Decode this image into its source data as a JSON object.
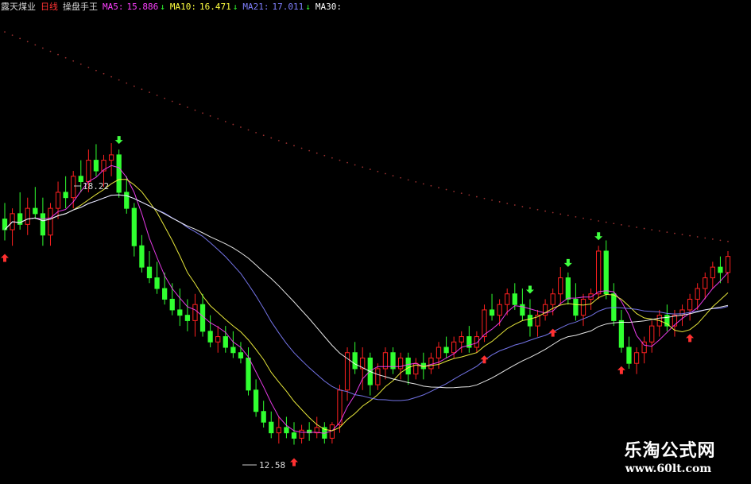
{
  "header": {
    "stock_name": "露天煤业",
    "period": "日线",
    "tool": "操盘手王",
    "ma_items": [
      {
        "label": "MA5:",
        "value": "15.886",
        "arrow": "↓",
        "color": "#ff40ff"
      },
      {
        "label": "MA10:",
        "value": "16.471",
        "arrow": "↓",
        "color": "#ffff40"
      },
      {
        "label": "MA21:",
        "value": "17.011",
        "arrow": "↓",
        "color": "#8080ff"
      },
      {
        "label": "MA30:",
        "value": "",
        "arrow": "",
        "color": "#ffffff"
      }
    ]
  },
  "annotations": {
    "high_label": "18.22",
    "low_label": "12.58"
  },
  "watermark": {
    "cn": "乐淘公式网",
    "url": "www.60lt.com"
  },
  "colors": {
    "background": "#000000",
    "up_candle": "#ff2020",
    "down_candle": "#30ff30",
    "ma5": "#ff40ff",
    "ma10": "#ffff40",
    "ma21": "#8080ff",
    "ma30": "#ffffff",
    "long_ma": "#9a3030",
    "buy_arrow": "#ff3030",
    "sell_arrow": "#40ff40"
  },
  "chart_data": {
    "type": "candlestick",
    "title": "",
    "ylim": [
      12.2,
      20.6
    ],
    "candles": [
      {
        "o": 16.8,
        "h": 17.1,
        "l": 16.4,
        "c": 16.6
      },
      {
        "o": 16.6,
        "h": 17.0,
        "l": 16.3,
        "c": 16.9
      },
      {
        "o": 16.9,
        "h": 17.3,
        "l": 16.6,
        "c": 16.7
      },
      {
        "o": 16.7,
        "h": 17.2,
        "l": 16.5,
        "c": 17.0
      },
      {
        "o": 17.0,
        "h": 17.4,
        "l": 16.8,
        "c": 16.9
      },
      {
        "o": 16.9,
        "h": 17.2,
        "l": 16.3,
        "c": 16.5
      },
      {
        "o": 16.5,
        "h": 17.1,
        "l": 16.3,
        "c": 17.0
      },
      {
        "o": 17.0,
        "h": 17.5,
        "l": 16.8,
        "c": 17.3
      },
      {
        "o": 17.3,
        "h": 17.6,
        "l": 17.0,
        "c": 17.2
      },
      {
        "o": 17.2,
        "h": 17.7,
        "l": 17.0,
        "c": 17.6
      },
      {
        "o": 17.6,
        "h": 17.9,
        "l": 17.3,
        "c": 17.5
      },
      {
        "o": 17.5,
        "h": 18.1,
        "l": 17.3,
        "c": 17.9
      },
      {
        "o": 17.9,
        "h": 18.2,
        "l": 17.6,
        "c": 17.7
      },
      {
        "o": 17.7,
        "h": 18.0,
        "l": 17.4,
        "c": 17.9
      },
      {
        "o": 17.9,
        "h": 18.22,
        "l": 17.6,
        "c": 18.0
      },
      {
        "o": 18.0,
        "h": 18.1,
        "l": 17.2,
        "c": 17.3
      },
      {
        "o": 17.3,
        "h": 17.6,
        "l": 16.9,
        "c": 17.0
      },
      {
        "o": 17.0,
        "h": 17.1,
        "l": 16.1,
        "c": 16.3
      },
      {
        "o": 16.3,
        "h": 16.5,
        "l": 15.8,
        "c": 15.9
      },
      {
        "o": 15.9,
        "h": 16.2,
        "l": 15.6,
        "c": 15.7
      },
      {
        "o": 15.7,
        "h": 16.0,
        "l": 15.4,
        "c": 15.5
      },
      {
        "o": 15.5,
        "h": 15.8,
        "l": 15.2,
        "c": 15.3
      },
      {
        "o": 15.3,
        "h": 15.6,
        "l": 15.0,
        "c": 15.1
      },
      {
        "o": 15.1,
        "h": 15.5,
        "l": 14.8,
        "c": 15.0
      },
      {
        "o": 15.0,
        "h": 15.3,
        "l": 14.7,
        "c": 14.9
      },
      {
        "o": 14.9,
        "h": 15.4,
        "l": 14.6,
        "c": 15.2
      },
      {
        "o": 15.2,
        "h": 15.4,
        "l": 14.6,
        "c": 14.7
      },
      {
        "o": 14.7,
        "h": 15.0,
        "l": 14.4,
        "c": 14.5
      },
      {
        "o": 14.5,
        "h": 14.8,
        "l": 14.3,
        "c": 14.6
      },
      {
        "o": 14.6,
        "h": 14.8,
        "l": 14.3,
        "c": 14.4
      },
      {
        "o": 14.4,
        "h": 14.7,
        "l": 14.2,
        "c": 14.3
      },
      {
        "o": 14.3,
        "h": 14.5,
        "l": 14.1,
        "c": 14.2
      },
      {
        "o": 14.2,
        "h": 14.4,
        "l": 13.5,
        "c": 13.6
      },
      {
        "o": 13.6,
        "h": 13.8,
        "l": 13.1,
        "c": 13.2
      },
      {
        "o": 13.2,
        "h": 13.4,
        "l": 12.9,
        "c": 13.0
      },
      {
        "o": 13.0,
        "h": 13.2,
        "l": 12.7,
        "c": 12.8
      },
      {
        "o": 12.8,
        "h": 13.1,
        "l": 12.6,
        "c": 12.9
      },
      {
        "o": 12.9,
        "h": 13.1,
        "l": 12.7,
        "c": 12.8
      },
      {
        "o": 12.8,
        "h": 13.0,
        "l": 12.58,
        "c": 12.7
      },
      {
        "o": 12.7,
        "h": 12.95,
        "l": 12.6,
        "c": 12.85
      },
      {
        "o": 12.85,
        "h": 13.0,
        "l": 12.65,
        "c": 12.8
      },
      {
        "o": 12.8,
        "h": 13.1,
        "l": 12.7,
        "c": 12.9
      },
      {
        "o": 12.9,
        "h": 13.0,
        "l": 12.6,
        "c": 12.7
      },
      {
        "o": 12.7,
        "h": 13.0,
        "l": 12.6,
        "c": 12.95
      },
      {
        "o": 12.95,
        "h": 13.7,
        "l": 12.8,
        "c": 13.6
      },
      {
        "o": 13.6,
        "h": 14.4,
        "l": 13.4,
        "c": 14.3
      },
      {
        "o": 14.3,
        "h": 14.5,
        "l": 13.9,
        "c": 14.0
      },
      {
        "o": 14.0,
        "h": 14.4,
        "l": 13.6,
        "c": 14.2
      },
      {
        "o": 14.2,
        "h": 14.3,
        "l": 13.5,
        "c": 13.7
      },
      {
        "o": 13.7,
        "h": 14.1,
        "l": 13.6,
        "c": 14.0
      },
      {
        "o": 14.0,
        "h": 14.4,
        "l": 13.8,
        "c": 14.3
      },
      {
        "o": 14.3,
        "h": 14.4,
        "l": 13.9,
        "c": 14.0
      },
      {
        "o": 14.0,
        "h": 14.3,
        "l": 13.8,
        "c": 14.2
      },
      {
        "o": 14.2,
        "h": 14.3,
        "l": 13.7,
        "c": 13.9
      },
      {
        "o": 13.9,
        "h": 14.2,
        "l": 13.8,
        "c": 14.1
      },
      {
        "o": 14.1,
        "h": 14.3,
        "l": 13.8,
        "c": 14.0
      },
      {
        "o": 14.0,
        "h": 14.3,
        "l": 13.9,
        "c": 14.2
      },
      {
        "o": 14.2,
        "h": 14.5,
        "l": 14.0,
        "c": 14.4
      },
      {
        "o": 14.4,
        "h": 14.6,
        "l": 14.2,
        "c": 14.3
      },
      {
        "o": 14.3,
        "h": 14.6,
        "l": 14.2,
        "c": 14.5
      },
      {
        "o": 14.5,
        "h": 14.7,
        "l": 14.3,
        "c": 14.6
      },
      {
        "o": 14.6,
        "h": 14.8,
        "l": 14.3,
        "c": 14.4
      },
      {
        "o": 14.4,
        "h": 14.7,
        "l": 14.3,
        "c": 14.6
      },
      {
        "o": 14.6,
        "h": 15.2,
        "l": 14.5,
        "c": 15.1
      },
      {
        "o": 15.1,
        "h": 15.4,
        "l": 14.9,
        "c": 15.0
      },
      {
        "o": 15.0,
        "h": 15.3,
        "l": 14.8,
        "c": 15.2
      },
      {
        "o": 15.2,
        "h": 15.5,
        "l": 15.0,
        "c": 15.4
      },
      {
        "o": 15.4,
        "h": 15.6,
        "l": 15.1,
        "c": 15.2
      },
      {
        "o": 15.2,
        "h": 15.5,
        "l": 14.9,
        "c": 15.0
      },
      {
        "o": 15.0,
        "h": 15.3,
        "l": 14.6,
        "c": 14.8
      },
      {
        "o": 14.8,
        "h": 15.1,
        "l": 14.6,
        "c": 15.0
      },
      {
        "o": 15.0,
        "h": 15.3,
        "l": 14.9,
        "c": 15.2
      },
      {
        "o": 15.2,
        "h": 15.5,
        "l": 15.0,
        "c": 15.4
      },
      {
        "o": 15.4,
        "h": 15.9,
        "l": 15.2,
        "c": 15.7
      },
      {
        "o": 15.7,
        "h": 15.8,
        "l": 15.2,
        "c": 15.3
      },
      {
        "o": 15.3,
        "h": 15.6,
        "l": 14.9,
        "c": 15.0
      },
      {
        "o": 15.0,
        "h": 15.4,
        "l": 14.8,
        "c": 15.3
      },
      {
        "o": 15.3,
        "h": 15.5,
        "l": 15.1,
        "c": 15.4
      },
      {
        "o": 15.4,
        "h": 16.3,
        "l": 15.3,
        "c": 16.2
      },
      {
        "o": 16.2,
        "h": 16.4,
        "l": 15.3,
        "c": 15.4
      },
      {
        "o": 15.4,
        "h": 15.6,
        "l": 14.8,
        "c": 14.9
      },
      {
        "o": 14.9,
        "h": 15.1,
        "l": 14.3,
        "c": 14.4
      },
      {
        "o": 14.4,
        "h": 14.6,
        "l": 14.0,
        "c": 14.1
      },
      {
        "o": 14.1,
        "h": 14.4,
        "l": 13.9,
        "c": 14.3
      },
      {
        "o": 14.3,
        "h": 14.6,
        "l": 14.1,
        "c": 14.5
      },
      {
        "o": 14.5,
        "h": 14.9,
        "l": 14.3,
        "c": 14.8
      },
      {
        "o": 14.8,
        "h": 15.1,
        "l": 14.6,
        "c": 15.0
      },
      {
        "o": 15.0,
        "h": 15.2,
        "l": 14.7,
        "c": 14.8
      },
      {
        "o": 14.8,
        "h": 15.1,
        "l": 14.6,
        "c": 15.0
      },
      {
        "o": 15.0,
        "h": 15.2,
        "l": 14.8,
        "c": 15.1
      },
      {
        "o": 15.1,
        "h": 15.4,
        "l": 14.9,
        "c": 15.3
      },
      {
        "o": 15.3,
        "h": 15.6,
        "l": 15.1,
        "c": 15.5
      },
      {
        "o": 15.5,
        "h": 15.8,
        "l": 15.3,
        "c": 15.7
      },
      {
        "o": 15.7,
        "h": 16.0,
        "l": 15.5,
        "c": 15.9
      },
      {
        "o": 15.9,
        "h": 16.1,
        "l": 15.6,
        "c": 15.8
      },
      {
        "o": 15.8,
        "h": 16.2,
        "l": 15.6,
        "c": 16.1
      }
    ]
  }
}
